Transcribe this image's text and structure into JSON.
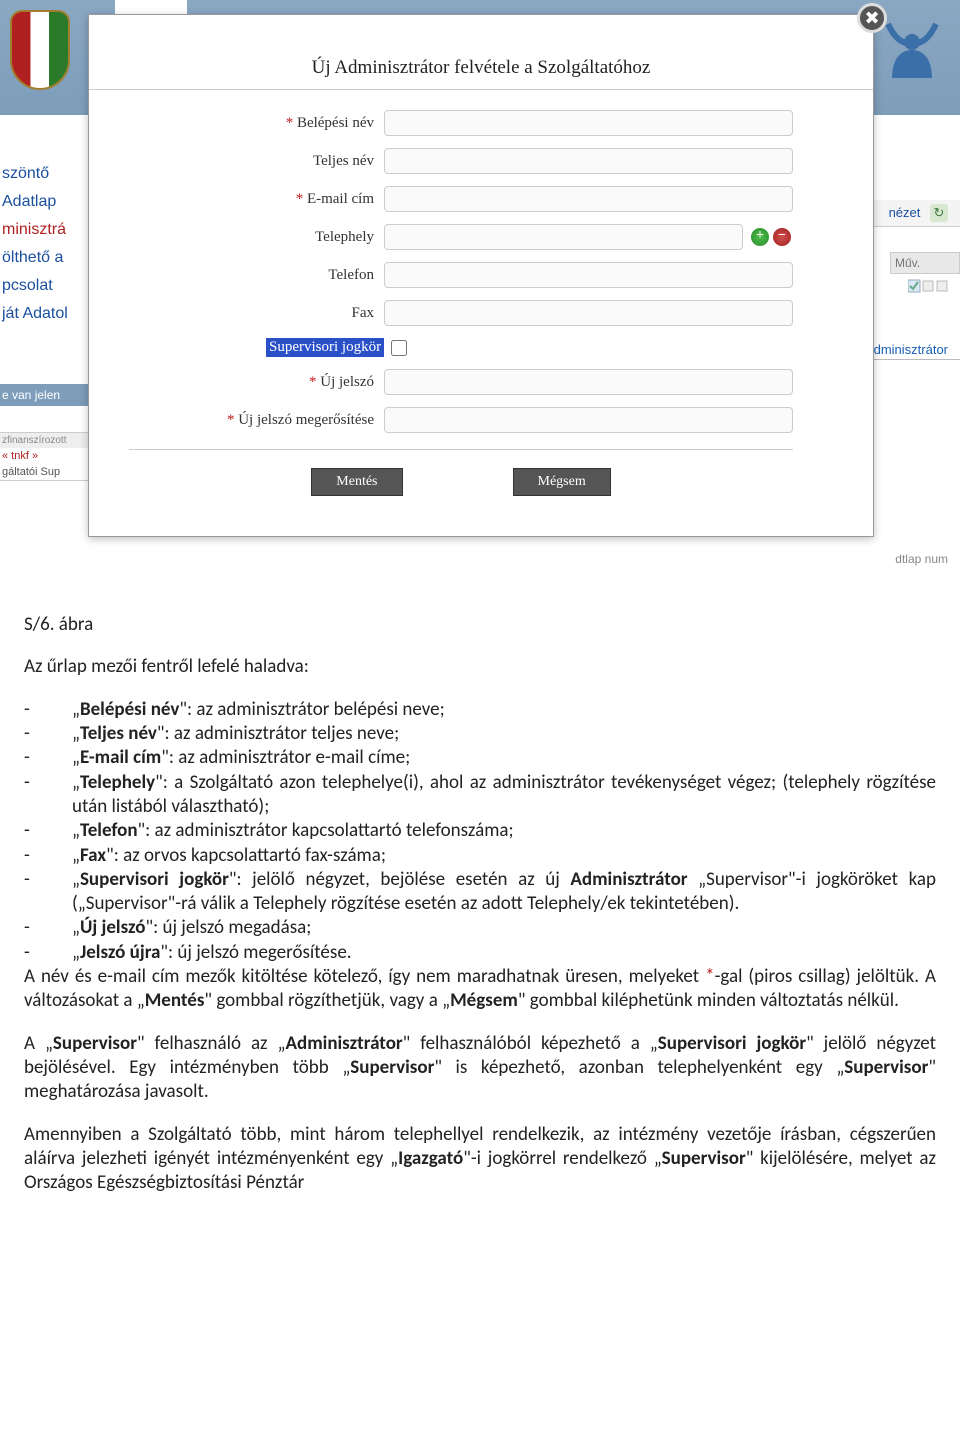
{
  "sidebar": {
    "items": [
      {
        "label": "szöntő"
      },
      {
        "label": "Adatlap"
      },
      {
        "label": "minisztrá"
      },
      {
        "label": "ölthető a"
      },
      {
        "label": "pcsolat"
      },
      {
        "label": "ját Adatol"
      }
    ],
    "login_bar": "e van jelen",
    "footer1": "zfinanszírozott",
    "footer2": "« tnkf »",
    "footer3": "gáltatói Sup"
  },
  "right_bg": {
    "nezet": "nézet",
    "muv": "Műv.",
    "admin": "Adminisztrátor",
    "dtlap": "dtlap num"
  },
  "modal": {
    "title": "Új Adminisztrátor felvétele a Szolgáltatóhoz",
    "fields": {
      "belepesi_nev": {
        "label": "Belépési név",
        "required": true
      },
      "teljes_nev": {
        "label": "Teljes név",
        "required": false
      },
      "email": {
        "label": "E-mail cím",
        "required": true
      },
      "telephely": {
        "label": "Telephely",
        "required": false
      },
      "telefon": {
        "label": "Telefon",
        "required": false
      },
      "fax": {
        "label": "Fax",
        "required": false
      },
      "supervisor": {
        "label": "Supervisori jogkör",
        "required": false
      },
      "uj_jelszo": {
        "label": "Új jelszó",
        "required": true
      },
      "jelszo_meger": {
        "label": "Új jelszó megerősítése",
        "required": true
      }
    },
    "save": "Mentés",
    "cancel": "Mégsem"
  },
  "doc": {
    "caption": "S/6. ábra",
    "intro": "Az űrlap mezői fentről lefelé haladva:",
    "bullets": [
      {
        "b": "Belépési név",
        "t": ": az adminisztrátor belépési neve;",
        "quoted": true
      },
      {
        "b": "Teljes név",
        "t": ": az adminisztrátor teljes neve;",
        "quoted": true
      },
      {
        "b": "E-mail cím",
        "t": ": az adminisztrátor e-mail címe;",
        "quoted": true
      },
      {
        "b": "Telephely",
        "t": ": a Szolgáltató azon telephelye(i), ahol az adminisztrátor tevékenységet végez; (telephely rögzítése után listából választható);",
        "quoted": true
      },
      {
        "b": "Telefon",
        "t": ": az adminisztrátor kapcsolattartó telefonszáma;",
        "quoted": true
      },
      {
        "b": "Fax",
        "t": ": az orvos kapcsolattartó fax-száma;",
        "quoted": true
      }
    ],
    "supervisor_li_html": "„<b>Supervisori jogkör</b>\": jelölő négyzet, bejölése esetén az új <b>Adminisztrátor</b> „Supervisor\"-i jogköröket kap („Supervisor\"-rá válik a Telephely rögzítése esetén az adott Telephely/ek tekintetében).",
    "uj_jelszo_li": "„Új jelszó\": új jelszó megadása;",
    "jelszo_ujra_li": "„Jelszó újra\": új jelszó megerősítése.",
    "p1_html": "A név és e-mail cím mezők kitöltése kötelező, így nem maradhatnak üresen, melyeket <span class='star'>*</span>-gal (piros csillag) jelöltük. A változásokat a „<b>Mentés</b>\" gombbal rögzíthetjük, vagy a „<b>Mégsem</b>\" gombbal kiléphetünk minden változtatás nélkül.",
    "p2_html": "A „<b>Supervisor</b>\" felhasználó az „<b>Adminisztrátor</b>\" felhasználóból képezhető a „<b>Supervisori jogkör</b>\" jelölő négyzet bejölésével. Egy intézményben több „<b>Supervisor</b>\" is képezhető, azonban telephelyenként egy „<b>Supervisor</b>\" meghatározása javasolt.",
    "p3_html": "Amennyiben a Szolgáltató több, mint három telephellyel rendelkezik, az intézmény vezetője írásban, cégszerűen aláírva jelezheti igényét intézményenként egy „<b>Igazgató</b>\"-i jogkörrel rendelkező „<b>Supervisor</b>\" kijelölésére, melyet az Országos Egészségbiztosítási Pénztár"
  }
}
